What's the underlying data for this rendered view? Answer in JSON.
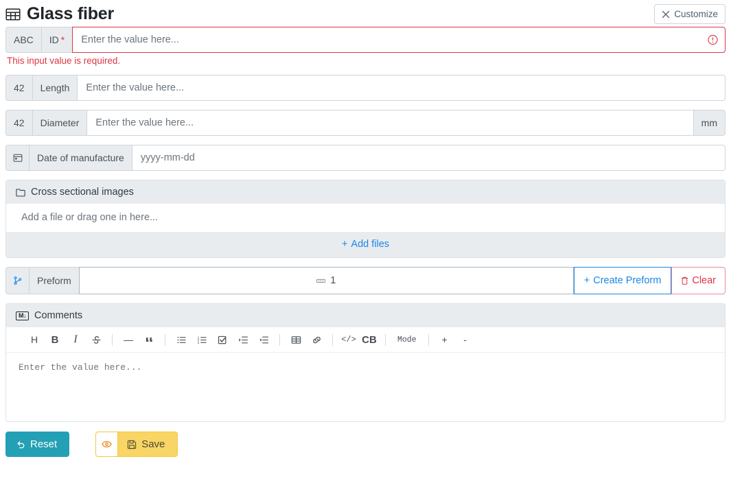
{
  "header": {
    "title": "Glass fiber",
    "title_icon": "table-icon",
    "customize_label": "Customize",
    "customize_icon": "wrench-icon"
  },
  "fields": {
    "id": {
      "type_badge": "ABC",
      "label": "ID",
      "required_marker": "*",
      "placeholder": "Enter the value here...",
      "value": "",
      "error": "This input value is required.",
      "error_icon": "exclamation-circle-icon",
      "state": "invalid"
    },
    "length": {
      "type_badge": "42",
      "label": "Length",
      "placeholder": "Enter the value here...",
      "value": ""
    },
    "diameter": {
      "type_badge": "42",
      "label": "Diameter",
      "placeholder": "Enter the value here...",
      "value": "",
      "unit": "mm"
    },
    "date_of_manufacture": {
      "type_icon": "calendar-icon",
      "label": "Date of manufacture",
      "placeholder": "yyyy-mm-dd",
      "value": ""
    }
  },
  "files_section": {
    "icon": "folder-icon",
    "title": "Cross sectional images",
    "drop_text": "Add a file or drag one in here...",
    "add_files_label": "Add files",
    "add_files_icon": "plus-icon"
  },
  "preform": {
    "type_icon": "branch-icon",
    "label": "Preform",
    "chip_icon": "record-icon",
    "chip_value": "1",
    "create_label": "Create Preform",
    "create_icon": "plus-icon",
    "clear_label": "Clear",
    "clear_icon": "trash-icon"
  },
  "comments": {
    "icon": "markdown-icon",
    "icon_text": "M↓",
    "title": "Comments",
    "placeholder": "Enter the value here...",
    "value": "",
    "toolbar": [
      {
        "name": "heading",
        "label": "H",
        "kind": "text"
      },
      {
        "name": "bold",
        "label": "B",
        "kind": "bold"
      },
      {
        "name": "italic",
        "label": "I",
        "kind": "ital"
      },
      {
        "name": "strikethrough",
        "label": "S",
        "kind": "strike"
      },
      {
        "name": "separator-1",
        "label": "",
        "kind": "sep"
      },
      {
        "name": "horizontal-rule",
        "label": "—",
        "kind": "text"
      },
      {
        "name": "blockquote",
        "label": "“",
        "kind": "quote"
      },
      {
        "name": "separator-2",
        "label": "",
        "kind": "sep"
      },
      {
        "name": "bullet-list",
        "label": "",
        "kind": "icon-ul"
      },
      {
        "name": "numbered-list",
        "label": "",
        "kind": "icon-ol"
      },
      {
        "name": "check-list",
        "label": "",
        "kind": "icon-check"
      },
      {
        "name": "indent",
        "label": "",
        "kind": "icon-indent"
      },
      {
        "name": "outdent",
        "label": "",
        "kind": "icon-outdent"
      },
      {
        "name": "separator-3",
        "label": "",
        "kind": "sep"
      },
      {
        "name": "table",
        "label": "",
        "kind": "icon-table"
      },
      {
        "name": "link",
        "label": "",
        "kind": "icon-link"
      },
      {
        "name": "separator-4",
        "label": "",
        "kind": "sep"
      },
      {
        "name": "inline-code",
        "label": "</>",
        "kind": "mono"
      },
      {
        "name": "code-block",
        "label": "CB",
        "kind": "bold"
      },
      {
        "name": "separator-5",
        "label": "",
        "kind": "sep"
      },
      {
        "name": "mode",
        "label": "Mode",
        "kind": "mode"
      },
      {
        "name": "separator-6",
        "label": "",
        "kind": "sep"
      },
      {
        "name": "zoom-in",
        "label": "+",
        "kind": "text"
      },
      {
        "name": "zoom-out",
        "label": "-",
        "kind": "text"
      }
    ]
  },
  "footer": {
    "reset_label": "Reset",
    "reset_icon": "undo-icon",
    "save_label": "Save",
    "save_icon": "floppy-icon",
    "preview_icon": "eye-icon"
  },
  "colors": {
    "danger": "#dc3545",
    "link": "#1a87e6",
    "reset": "#23a0b5",
    "save": "#f8d564",
    "addon_bg": "#e9ecef",
    "border": "#ced4da"
  }
}
